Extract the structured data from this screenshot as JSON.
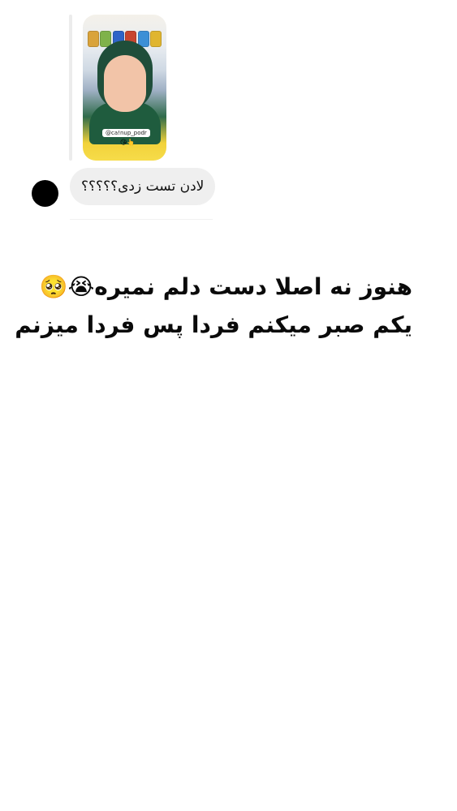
{
  "story_reply": {
    "thumbnail": {
      "tag_text": "@ca!nup_podr",
      "emoji_text": "😘👆",
      "jar_colors": [
        "#d9a33b",
        "#7fb24a",
        "#2f64c8",
        "#c8452f",
        "#3c8fd6",
        "#e0b52f"
      ]
    },
    "message": {
      "text": "لادن تست زدی؟؟؟؟؟",
      "sender_avatar_color": "#000000",
      "bubble_color": "#efefef"
    }
  },
  "caption": {
    "line_1": "هنوز نه اصلا دست دلم نمیره😭🥺",
    "line_2": "یکم صبر میکنم فردا پس فردا میزنم"
  }
}
